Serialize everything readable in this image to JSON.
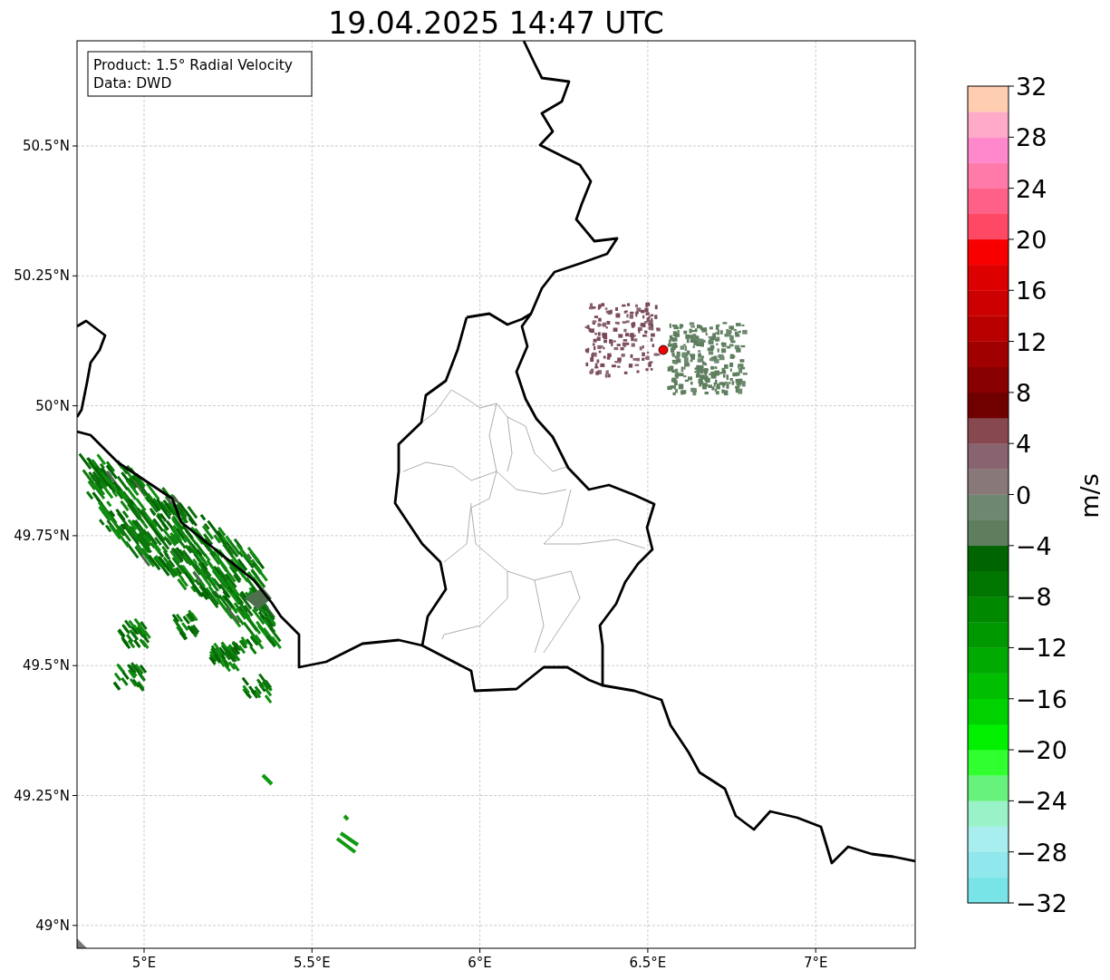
{
  "title": "19.04.2025 14:47 UTC",
  "info_box": [
    "Product: 1.5° Radial Velocity",
    "Data: DWD"
  ],
  "lat_labels": [
    "50.5°N",
    "50.25°N",
    "50°N",
    "49.75°N",
    "49.5°N",
    "49.25°N",
    "49°N"
  ],
  "lon_labels": [
    "5°E",
    "5.5°E",
    "6°E",
    "6.5°E",
    "7°E"
  ],
  "colorbar": {
    "label": "m/s",
    "ticks": [
      "32",
      "28",
      "24",
      "20",
      "16",
      "12",
      "8",
      "4",
      "0",
      "−4",
      "−8",
      "−12",
      "−16",
      "−20",
      "−24",
      "−28",
      "−32"
    ],
    "bands": [
      {
        "color": "#78e4e8"
      },
      {
        "color": "#90e8ec"
      },
      {
        "color": "#a8eeee"
      },
      {
        "color": "#99f2c8"
      },
      {
        "color": "#66f27c"
      },
      {
        "color": "#30ff30"
      },
      {
        "color": "#00f000"
      },
      {
        "color": "#00d200"
      },
      {
        "color": "#00be00"
      },
      {
        "color": "#00aa00"
      },
      {
        "color": "#009800"
      },
      {
        "color": "#008800"
      },
      {
        "color": "#007600"
      },
      {
        "color": "#006400"
      },
      {
        "color": "#5e7e5e"
      },
      {
        "color": "#6e8870"
      },
      {
        "color": "#887878"
      },
      {
        "color": "#886470"
      },
      {
        "color": "#884850"
      },
      {
        "color": "#700000"
      },
      {
        "color": "#880000"
      },
      {
        "color": "#a00000"
      },
      {
        "color": "#b80000"
      },
      {
        "color": "#cc0000"
      },
      {
        "color": "#dd0000"
      },
      {
        "color": "#f80000"
      },
      {
        "color": "#ff4864"
      },
      {
        "color": "#ff6088"
      },
      {
        "color": "#ff7aa8"
      },
      {
        "color": "#ff88cc"
      },
      {
        "color": "#ffaac8"
      },
      {
        "color": "#ffcdb0"
      }
    ]
  }
}
